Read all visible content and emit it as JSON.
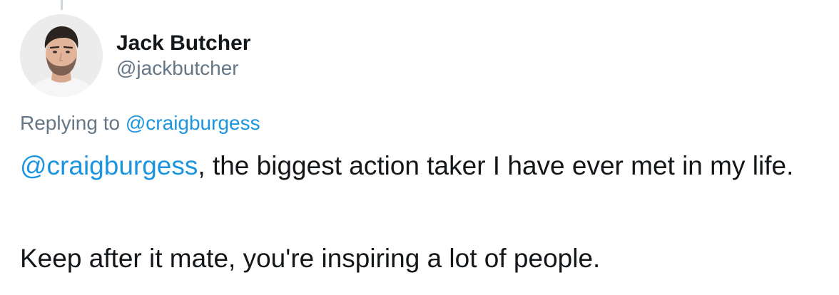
{
  "author": {
    "display_name": "Jack Butcher",
    "handle": "@jackbutcher",
    "avatar": "avatar-photo-man-dark-hair-beard"
  },
  "reply_context": {
    "prefix": "Replying to ",
    "mention": "@craigburgess"
  },
  "tweet": {
    "paragraph1_mention": "@craigburgess",
    "paragraph1_text": ", the biggest action taker I have ever met in my life.",
    "paragraph2_text": "Keep after it mate, you're inspiring a lot of people."
  },
  "colors": {
    "link": "#1b95e0",
    "secondary_text": "#657786",
    "primary_text": "#14171a",
    "thread_line": "#ccd6dd"
  }
}
